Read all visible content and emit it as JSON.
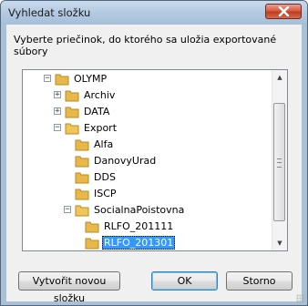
{
  "window": {
    "title": "Vyhledat složku",
    "close_icon": "close-icon"
  },
  "instruction": "Vyberte priečinok, do ktorého sa uložia exportované súbory",
  "tree": {
    "items": [
      {
        "label": "OLYMP",
        "expander": "−"
      },
      {
        "label": "Archiv",
        "expander": "+"
      },
      {
        "label": "DATA",
        "expander": "+"
      },
      {
        "label": "Export",
        "expander": "−"
      },
      {
        "label": "Alfa",
        "expander": ""
      },
      {
        "label": "DanovyUrad",
        "expander": ""
      },
      {
        "label": "DDS",
        "expander": ""
      },
      {
        "label": "ISCP",
        "expander": ""
      },
      {
        "label": "SocialnaPoistovna",
        "expander": "−"
      },
      {
        "label": "RLFO_201111",
        "expander": ""
      },
      {
        "label": "RLFO_201301",
        "expander": "",
        "selected": true
      }
    ],
    "scrollbar": {
      "up_icon": "▲",
      "down_icon": "▼"
    }
  },
  "buttons": {
    "new_folder": "Vytvořit novou složku",
    "ok": "OK",
    "cancel": "Storno"
  },
  "colors": {
    "selection": "#3399ff",
    "folder": "#e8b94a",
    "title_bar": "#b6cbe2",
    "close_button": "#c9432a"
  }
}
